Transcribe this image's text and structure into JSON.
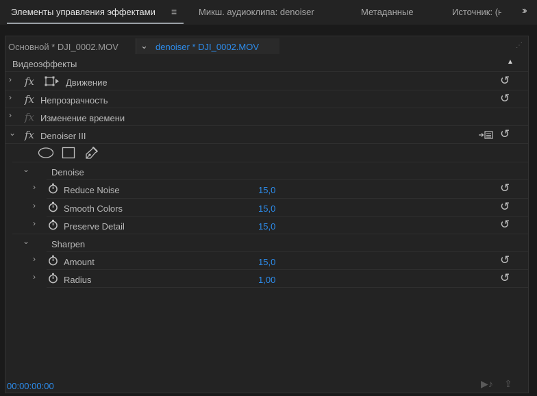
{
  "tabs": [
    {
      "label": "Элементы управления эффектами",
      "active": true
    },
    {
      "label": "Микш. аудиоклипа: denoiser",
      "active": false
    },
    {
      "label": "Метаданные",
      "active": false
    },
    {
      "label": "Источник: (н",
      "active": false
    }
  ],
  "clip_header": {
    "master_label": "Основной * DJI_0002.MOV",
    "clip_label": "denoiser * DJI_0002.MOV"
  },
  "section_title": "Видеоэффекты",
  "effects": [
    {
      "label": "Движение"
    },
    {
      "label": "Непрозрачность"
    },
    {
      "label": "Изменение времени"
    },
    {
      "label": "Denoiser III"
    }
  ],
  "groups": [
    {
      "label": "Denoise",
      "params": [
        {
          "label": "Reduce Noise",
          "value": "15,0"
        },
        {
          "label": "Smooth Colors",
          "value": "15,0"
        },
        {
          "label": "Preserve Detail",
          "value": "15,0"
        }
      ]
    },
    {
      "label": "Sharpen",
      "params": [
        {
          "label": "Amount",
          "value": "15,0"
        },
        {
          "label": "Radius",
          "value": "1,00"
        }
      ]
    }
  ],
  "footer": {
    "timecode": "00:00:00:00"
  },
  "colors": {
    "accent": "#2d8ceb",
    "panel": "#232323",
    "background": "#1a1a1a"
  }
}
